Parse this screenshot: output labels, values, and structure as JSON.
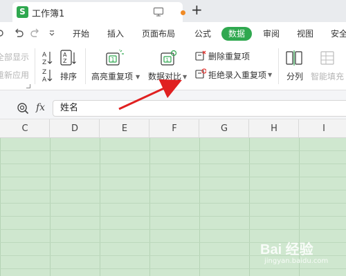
{
  "titlebar": {
    "doc_icon_letter": "S",
    "doc_title": "工作簿1"
  },
  "menubar": {
    "items": [
      "开始",
      "插入",
      "页面布局",
      "公式",
      "数据",
      "审阅",
      "视图",
      "安全"
    ],
    "active": "数据"
  },
  "ribbon": {
    "show_all": "全部显示",
    "reapply": "重新应用",
    "sort": "排序",
    "highlight_dup": "高亮重复项",
    "data_compare": "数据对比",
    "delete_dup": "删除重复项",
    "reject_dup": "拒绝录入重复项",
    "split": "分列",
    "smart_fill": "智能填充"
  },
  "formula": {
    "fx": "fx",
    "value": "姓名"
  },
  "columns": [
    "C",
    "D",
    "E",
    "F",
    "G",
    "H",
    "I"
  ],
  "watermark": {
    "text": "Bai 经验",
    "sub": "jingyan.baidu.com"
  },
  "colors": {
    "accent": "#2fa84f",
    "grid_fill": "#cfe7cf",
    "arrow": "#e02020"
  }
}
